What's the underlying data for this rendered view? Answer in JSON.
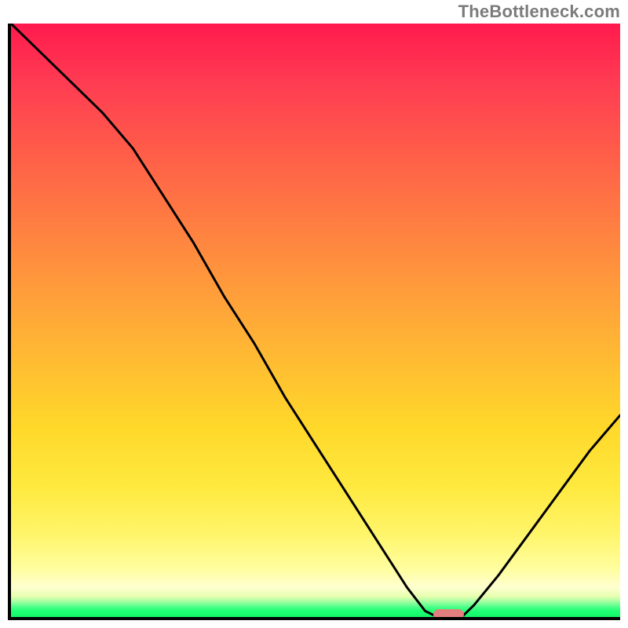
{
  "watermark": "TheBottleneck.com",
  "colors": {
    "gradient_top": "#ff1a4d",
    "gradient_mid": "#ffd82a",
    "gradient_bottom": "#14f56a",
    "curve": "#000000",
    "marker": "#e37f7f",
    "axis": "#000000"
  },
  "chart_data": {
    "type": "line",
    "title": "",
    "xlabel": "",
    "ylabel": "",
    "xlim": [
      0,
      100
    ],
    "ylim": [
      0,
      100
    ],
    "grid": false,
    "legend": false,
    "description": "V-shaped bottleneck curve. Starts top-left at (0,100), drops with a slight knee near x≈22, falls steeply to near zero around x≈68–74, stays near 0, then rises to about (100,34). Background is a vertical severity gradient red→yellow→green.",
    "series": [
      {
        "name": "bottleneck",
        "x": [
          0,
          5,
          10,
          15,
          20,
          25,
          30,
          35,
          40,
          45,
          50,
          55,
          60,
          65,
          68,
          70,
          72,
          74,
          76,
          80,
          85,
          90,
          95,
          100
        ],
        "values": [
          100,
          95,
          90,
          85,
          79,
          71,
          63,
          54,
          46,
          37,
          29,
          21,
          13,
          5,
          1,
          0,
          0,
          0,
          2,
          7,
          14,
          21,
          28,
          34
        ]
      }
    ],
    "marker": {
      "x_start": 69,
      "x_end": 74,
      "y": 0
    }
  }
}
